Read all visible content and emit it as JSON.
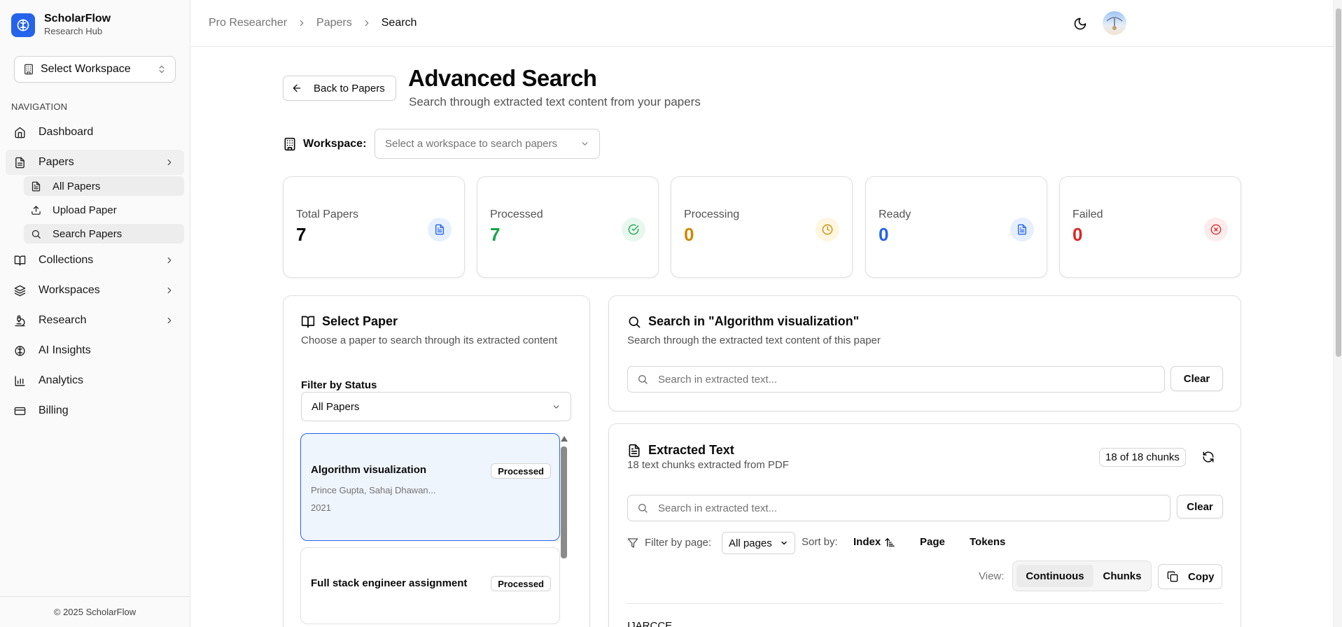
{
  "brand": {
    "name": "ScholarFlow",
    "subtitle": "Research Hub"
  },
  "sidebar": {
    "workspace_select": "Select Workspace",
    "nav_heading": "NAVIGATION",
    "items": [
      {
        "label": "Dashboard",
        "icon": "home-icon"
      },
      {
        "label": "Papers",
        "icon": "file-icon"
      },
      {
        "label": "Collections",
        "icon": "book-open-icon"
      },
      {
        "label": "Workspaces",
        "icon": "layers-icon"
      },
      {
        "label": "Research",
        "icon": "microscope-icon"
      },
      {
        "label": "AI Insights",
        "icon": "brain-icon"
      },
      {
        "label": "Analytics",
        "icon": "bar-chart-icon"
      },
      {
        "label": "Billing",
        "icon": "credit-card-icon"
      }
    ],
    "papers_sub": [
      {
        "label": "All Papers",
        "icon": "file-text-icon"
      },
      {
        "label": "Upload Paper",
        "icon": "upload-icon"
      },
      {
        "label": "Search Papers",
        "icon": "search-icon"
      }
    ],
    "footer": "© 2025 ScholarFlow"
  },
  "breadcrumb": [
    "Pro Researcher",
    "Papers",
    "Search"
  ],
  "header": {
    "back_label": "Back to Papers",
    "title": "Advanced Search",
    "subtitle": "Search through extracted text content from your papers",
    "workspace_label": "Workspace:",
    "workspace_placeholder": "Select a workspace to search papers"
  },
  "stats": [
    {
      "label": "Total Papers",
      "value": "7",
      "color": "#0a0a0a",
      "icon": "file-text-icon"
    },
    {
      "label": "Processed",
      "value": "7",
      "color": "#16a34a",
      "icon": "check-circle-icon"
    },
    {
      "label": "Processing",
      "value": "0",
      "color": "#ca8a04",
      "icon": "clock-icon"
    },
    {
      "label": "Ready",
      "value": "0",
      "color": "#2563eb",
      "icon": "file-text-icon"
    },
    {
      "label": "Failed",
      "value": "0",
      "color": "#dc2626",
      "icon": "x-circle-icon"
    }
  ],
  "select_paper": {
    "title": "Select Paper",
    "subtitle": "Choose a paper to search through its extracted content",
    "filter_label": "Filter by Status",
    "filter_value": "All Papers",
    "papers": [
      {
        "title": "Algorithm visualization",
        "status": "Processed",
        "authors": "Prince Gupta, Sahaj Dhawan...",
        "year": "2021"
      },
      {
        "title": "Full stack engineer assignment",
        "status": "Processed"
      }
    ]
  },
  "search_panel": {
    "title": "Search in \"Algorithm visualization\"",
    "subtitle": "Search through the extracted text content of this paper",
    "placeholder": "Search in extracted text...",
    "clear_label": "Clear"
  },
  "extracted": {
    "title": "Extracted Text",
    "subtitle": "18 text chunks extracted from PDF",
    "chunk_badge": "18 of 18 chunks",
    "placeholder": "Search in extracted text...",
    "clear_label": "Clear",
    "filter_label": "Filter by page:",
    "page_value": "All pages",
    "sort_label": "Sort by:",
    "sort_options": [
      "Index",
      "Page",
      "Tokens"
    ],
    "view_label": "View:",
    "view_options": [
      "Continuous",
      "Chunks"
    ],
    "copy_label": "Copy",
    "text_preview": "IJARCCE"
  }
}
